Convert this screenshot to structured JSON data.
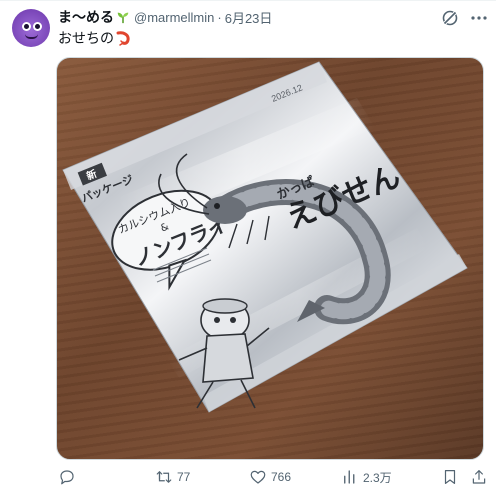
{
  "tweet": {
    "display_name": "ま〜める",
    "handle": "@marmellmin",
    "separator": "·",
    "date": "6月23日",
    "text": "おせちの",
    "text_emoji": "shrimp-emoji"
  },
  "media": {
    "package_date_stamp": "2026.12",
    "label_new": "新",
    "label_package": "パッケージ",
    "bubble_line1": "カルシウム入り",
    "bubble_line2": "&",
    "bubble_line3": "ノンフライ",
    "brand_small": "かっぱ",
    "brand_large": "えびせん"
  },
  "actions": {
    "reply_count": "",
    "retweet_count": "77",
    "like_count": "766",
    "views_count": "2.3万"
  },
  "icons": {
    "header": [
      "sprout-icon",
      "grok-icon",
      "more-icon"
    ],
    "actions": [
      "reply-icon",
      "retweet-icon",
      "like-icon",
      "views-icon",
      "bookmark-icon",
      "share-icon"
    ]
  },
  "colors": {
    "text_primary": "#0f1419",
    "text_secondary": "#536471",
    "border": "#cfd9de",
    "avatar": "#7a46b8"
  }
}
